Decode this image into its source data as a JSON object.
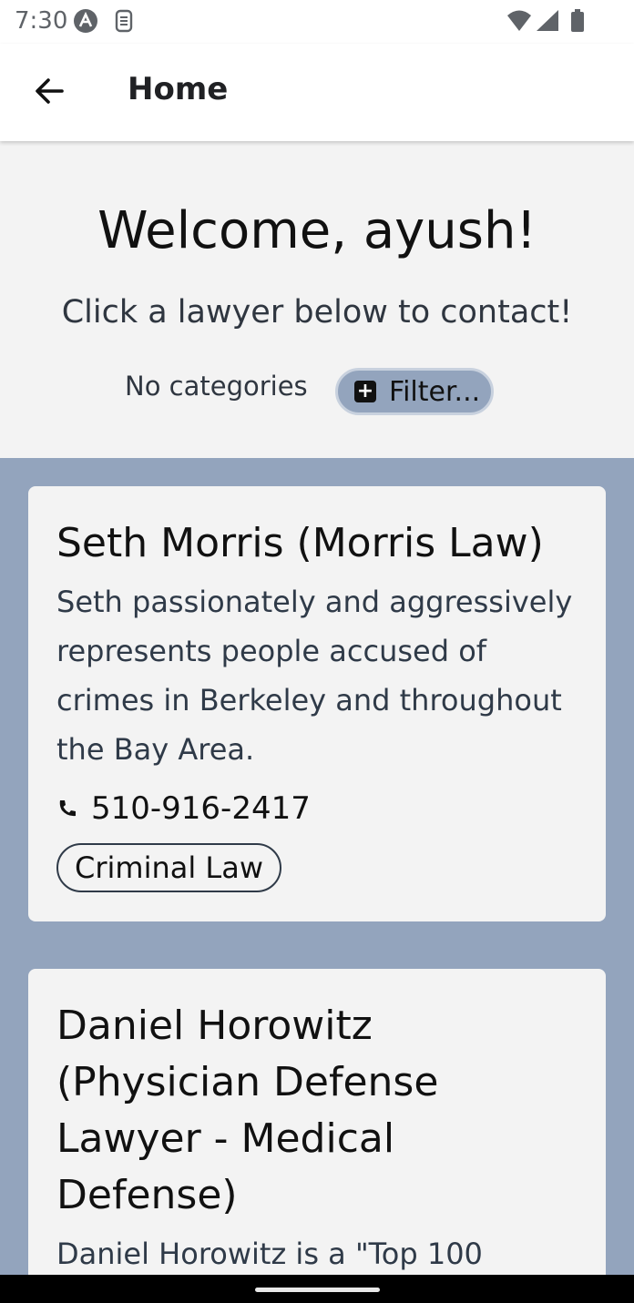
{
  "status_bar": {
    "time": "7:30",
    "icons": [
      "autofill-icon",
      "sim-icon",
      "wifi-icon",
      "signal-icon",
      "battery-icon"
    ]
  },
  "app_bar": {
    "back_icon": "arrow-left-icon",
    "title": "Home"
  },
  "hero": {
    "welcome": "Welcome, ayush!",
    "subtitle": "Click a lawyer below to contact!",
    "categories_label": "No categories",
    "filter_button": {
      "icon": "plus-box-icon",
      "label": "Filter..."
    }
  },
  "lawyers": [
    {
      "name": "Seth Morris (Morris Law)",
      "description": "Seth passionately and aggressively represents people accused of crimes in Berkeley and throughout the Bay Area.",
      "phone_icon": "phone-icon",
      "phone": "510-916-2417",
      "category": "Criminal Law"
    },
    {
      "name": "Daniel Horowitz (Physician Defense Lawyer - Medical Defense)",
      "description": "Daniel Horowitz is a \"Top 100"
    }
  ],
  "colors": {
    "background": "#f3f3f3",
    "list_background": "#93a4bd",
    "filter_button": "#93a4bd",
    "card": "#f3f3f3"
  }
}
